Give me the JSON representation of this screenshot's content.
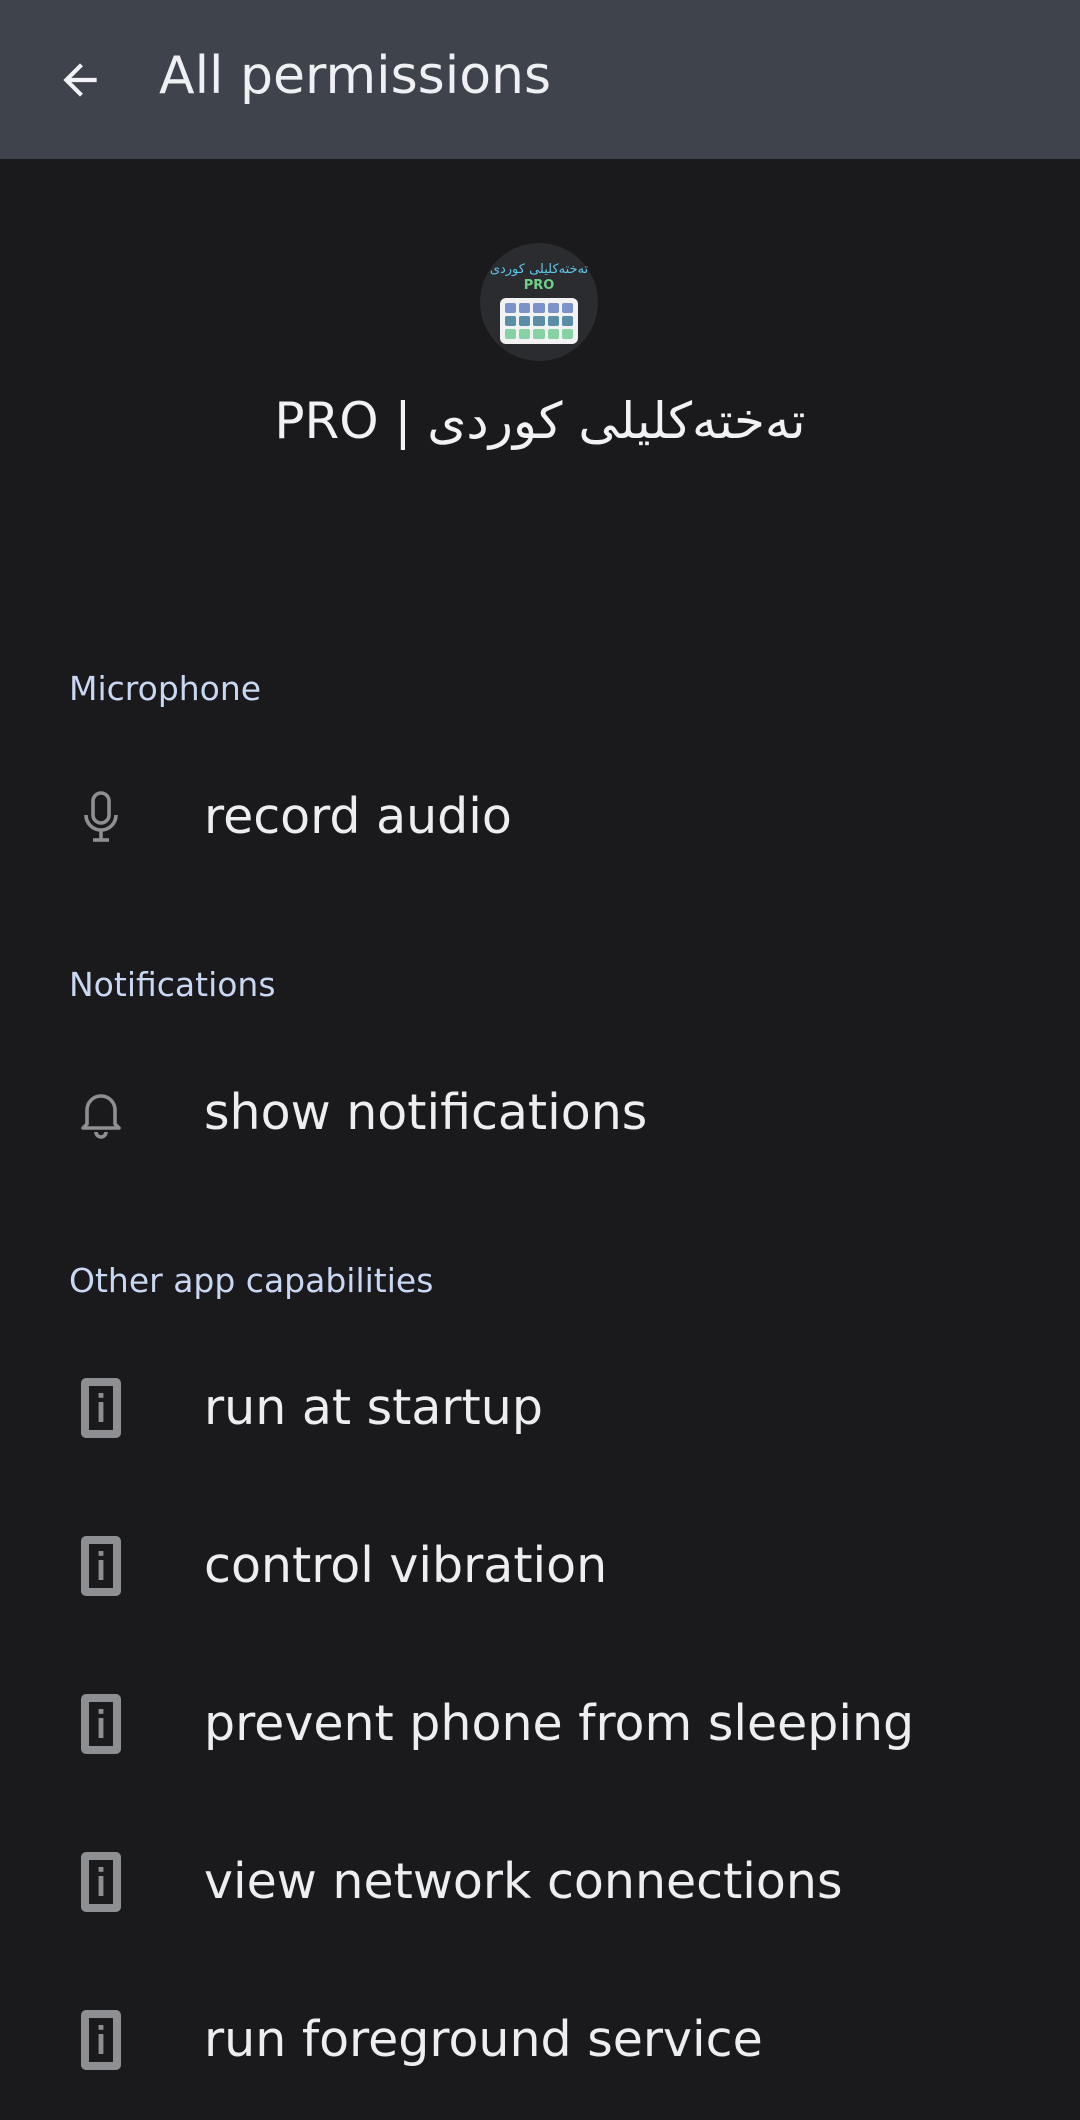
{
  "appbar": {
    "title": "All permissions",
    "back_icon": "arrow-back-icon"
  },
  "app": {
    "name": "PRO | تەختەکلیلی کوردی",
    "icon_caption_ar": "تەختەکلیلی کوردی",
    "icon_caption_pro": "PRO"
  },
  "sections": [
    {
      "title": "Microphone",
      "items": [
        {
          "label": "record audio",
          "icon": "microphone-icon"
        }
      ]
    },
    {
      "title": "Notifications",
      "items": [
        {
          "label": "show notifications",
          "icon": "bell-icon"
        }
      ]
    },
    {
      "title": "Other app capabilities",
      "items": [
        {
          "label": "run at startup",
          "icon": "info-device-icon"
        },
        {
          "label": "control vibration",
          "icon": "info-device-icon"
        },
        {
          "label": "prevent phone from sleeping",
          "icon": "info-device-icon"
        },
        {
          "label": "view network connections",
          "icon": "info-device-icon"
        },
        {
          "label": "run foreground service",
          "icon": "info-device-icon"
        }
      ]
    }
  ],
  "colors": {
    "background": "#1a1a1c",
    "appbar": "#3e434c",
    "section_title": "#c8d8f2",
    "icon": "#8e8f93"
  }
}
